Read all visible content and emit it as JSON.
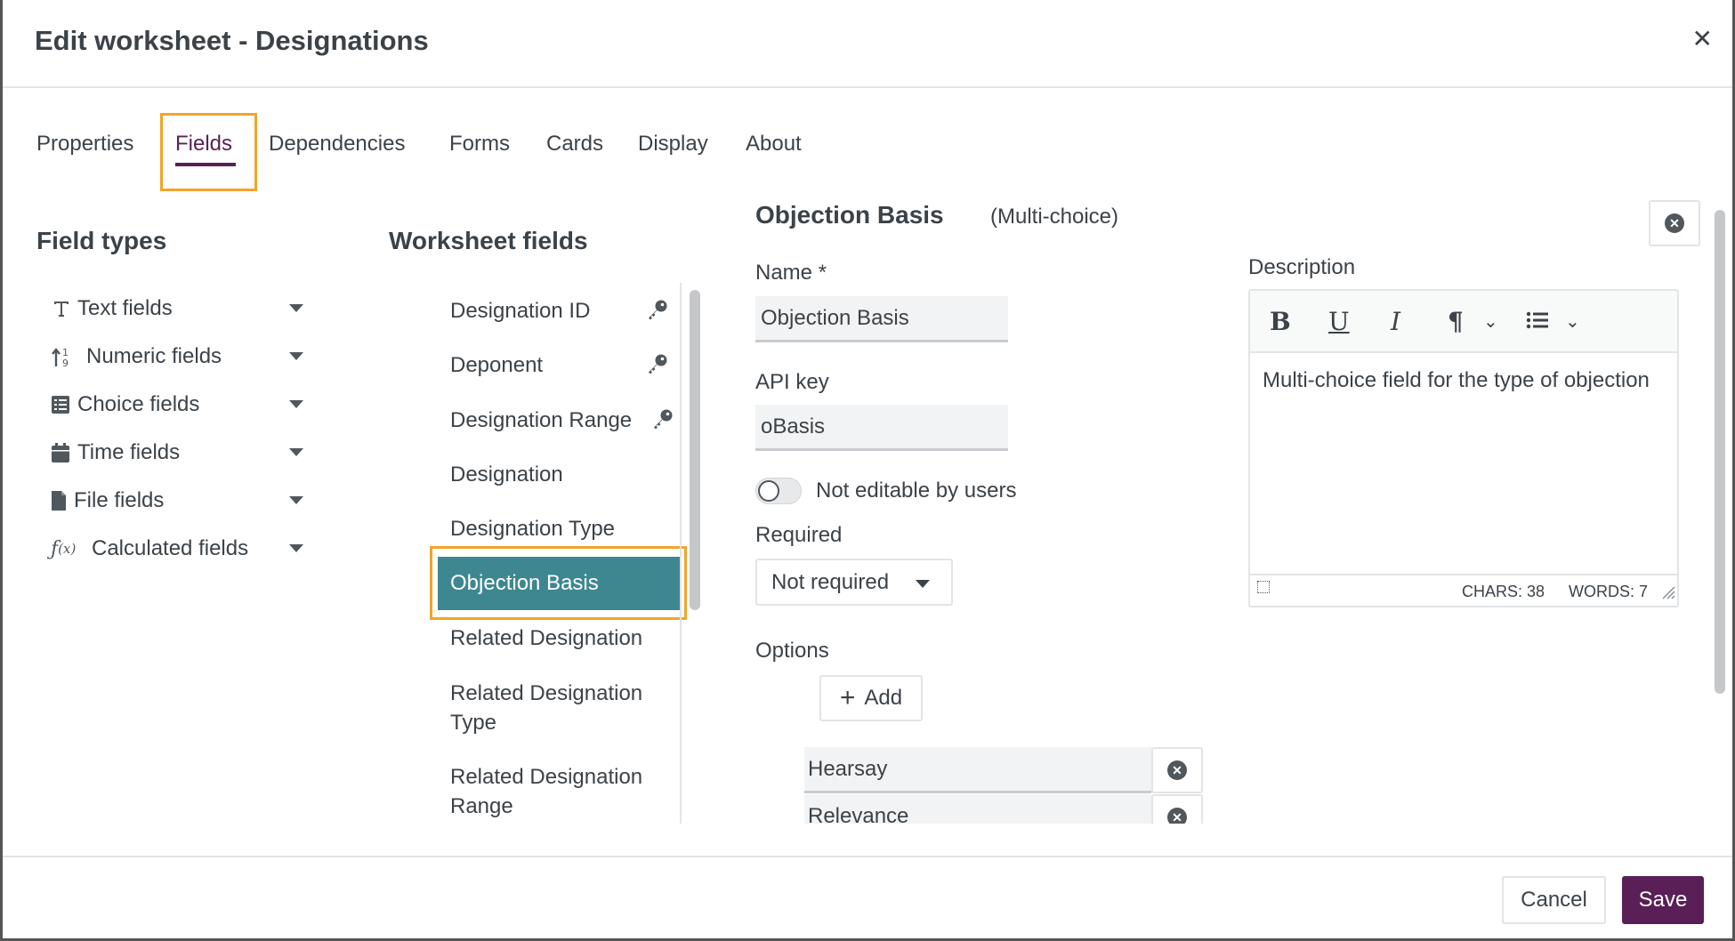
{
  "dialog": {
    "title": "Edit worksheet - Designations"
  },
  "tabs": [
    {
      "label": "Properties"
    },
    {
      "label": "Fields",
      "active": true
    },
    {
      "label": "Dependencies"
    },
    {
      "label": "Forms"
    },
    {
      "label": "Cards"
    },
    {
      "label": "Display"
    },
    {
      "label": "About"
    }
  ],
  "field_types": {
    "heading": "Field types",
    "items": [
      {
        "label": "Text fields",
        "icon": "text-icon"
      },
      {
        "label": "Numeric fields",
        "icon": "numeric-icon"
      },
      {
        "label": "Choice fields",
        "icon": "list-icon"
      },
      {
        "label": "Time fields",
        "icon": "calendar-icon"
      },
      {
        "label": "File fields",
        "icon": "file-icon"
      },
      {
        "label": "Calculated fields",
        "icon": "function-icon"
      }
    ]
  },
  "worksheet_fields": {
    "heading": "Worksheet fields",
    "items": [
      {
        "label": "Designation ID",
        "key": true
      },
      {
        "label": "Deponent",
        "key": true
      },
      {
        "label": "Designation Range",
        "key": true
      },
      {
        "label": "Designation"
      },
      {
        "label": "Designation Type"
      },
      {
        "label": "Objection Basis",
        "selected": true
      },
      {
        "label": "Related Designation"
      },
      {
        "label": "Related Designation Type"
      },
      {
        "label": "Related Designation Range"
      }
    ]
  },
  "field_editor": {
    "field_name": "Objection Basis",
    "field_type": "(Multi-choice)",
    "name_label": "Name *",
    "name_value": "Objection Basis",
    "api_key_label": "API key",
    "api_key_value": "oBasis",
    "not_editable_label": "Not editable by users",
    "not_editable": false,
    "required_label": "Required",
    "required_value": "Not required",
    "options_label": "Options",
    "add_label": "Add",
    "options": [
      "Hearsay",
      "Relevance"
    ]
  },
  "description": {
    "label": "Description",
    "text": "Multi-choice field for the type of objection",
    "chars": "CHARS: 38",
    "words": "WORDS: 7"
  },
  "footer": {
    "cancel_label": "Cancel",
    "save_label": "Save"
  },
  "colors": {
    "accent": "#5a1f56",
    "selected_row": "#3e8790",
    "highlight": "#f3a428"
  }
}
